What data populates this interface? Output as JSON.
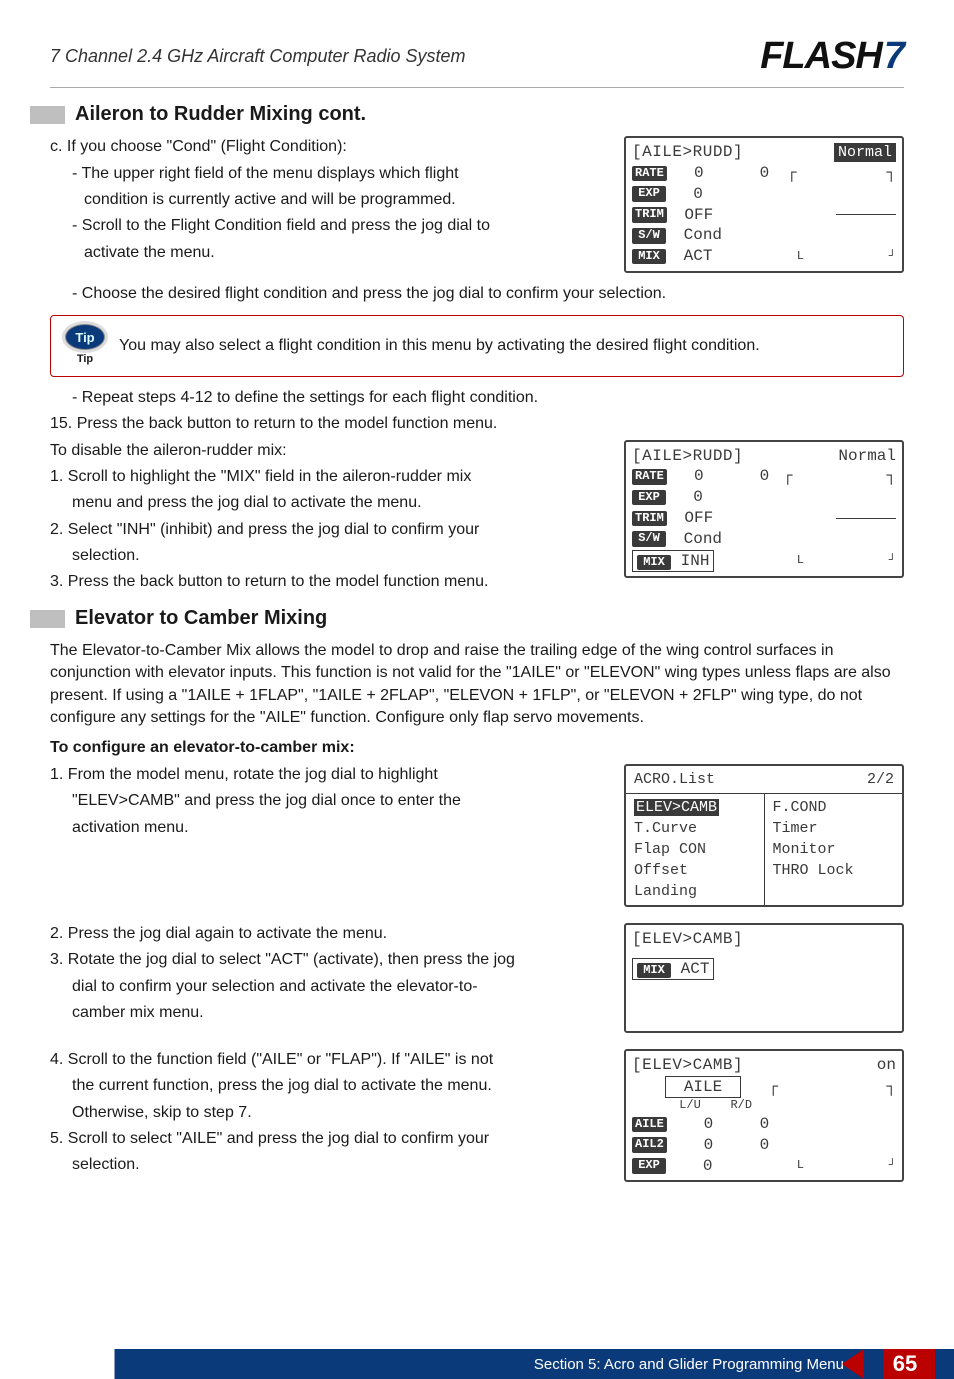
{
  "header": {
    "title_italic": "7 Channel 2.4 GHz Aircraft Computer Radio System",
    "logo_main": "FLASH",
    "logo_num": "7"
  },
  "section1": {
    "title": "Aileron to Rudder Mixing cont.",
    "c_line": "c. If you choose \"Cond\" (Flight Condition):",
    "c1a": "- The upper right field of the menu displays which flight",
    "c1b": "condition is currently active and will be programmed.",
    "c2a": "- Scroll to the Flight Condition field and press the jog dial to",
    "c2b": "activate the menu.",
    "c3": "- Choose the desired flight condition and press the jog dial to confirm your selection.",
    "tip": "You may also select a flight condition in this menu by activating the desired flight condition.",
    "tip_icon": "Tip",
    "tip_label": "Tip",
    "r412": "- Repeat steps 4-12 to define the settings for each flight condition.",
    "s15": "15. Press the back button to return to the model function menu.",
    "disable": "To disable the aileron-rudder mix:",
    "d1a": "1. Scroll to highlight the \"MIX\" field in the aileron-rudder mix",
    "d1b": "menu and press the jog dial to activate the menu.",
    "d2a": "2. Select \"INH\" (inhibit) and press the jog dial to confirm your",
    "d2b": "selection.",
    "d3": "3. Press the back button to return to the model function menu."
  },
  "lcd1": {
    "title": "[AILE>RUDD]",
    "badge_norm": "Normal",
    "rate_lbl": "RATE",
    "rate_v": "0",
    "rate_r": "0",
    "exp_lbl": "EXP",
    "exp_v": "0",
    "trim_lbl": "TRIM",
    "trim_v": "OFF",
    "sw_lbl": "S/W",
    "sw_v": "Cond",
    "mix_lbl": "MIX",
    "mix_v": "ACT",
    "lr_l": "L",
    "lr_r": "┘",
    "bar_r": "┌",
    "bar_top": "┐"
  },
  "lcd2": {
    "title": "[AILE>RUDD]",
    "badge_norm": "Normal",
    "rate_lbl": "RATE",
    "rate_v": "0",
    "rate_r": "0",
    "exp_lbl": "EXP",
    "exp_v": "0",
    "trim_lbl": "TRIM",
    "trim_v": "OFF",
    "sw_lbl": "S/W",
    "sw_v": "Cond",
    "mix_lbl": "MIX",
    "mix_v": "INH"
  },
  "section2": {
    "title": "Elevator to Camber Mixing",
    "para": "The Elevator-to-Camber Mix allows the model to drop and raise the trailing edge of the wing control surfaces in conjunction with elevator inputs. This function is not valid for the \"1AILE\" or \"ELEVON\" wing types unless flaps are also present. If using a \"1AILE + 1FLAP\", \"1AILE + 2FLAP\", \"ELEVON + 1FLP\", or \"ELEVON + 2FLP\" wing type, do not configure any settings for the \"AILE\" function. Configure only flap servo movements.",
    "config_h": "To configure an elevator-to-camber mix:",
    "s1a": "1. From the model menu, rotate the jog dial to highlight",
    "s1b": "\"ELEV>CAMB\" and press the jog dial once to enter the",
    "s1c": "activation menu.",
    "s2": "2. Press the jog dial again to activate the menu.",
    "s3a": "3. Rotate the jog dial to select \"ACT\" (activate), then press the jog",
    "s3b": "dial to confirm your selection and activate the elevator-to-",
    "s3c": "camber mix menu.",
    "s4a": "4. Scroll to the function field (\"AILE\" or \"FLAP\"). If \"AILE\" is not",
    "s4b": "the current function, press the jog dial to activate the menu.",
    "s4c": "Otherwise, skip to step 7.",
    "s5a": "5. Scroll to select \"AILE\" and press the jog dial to confirm your",
    "s5b": "selection."
  },
  "lcd3": {
    "head_l": "ACRO.List",
    "head_r": "2/2",
    "l1": "ELEV>CAMB",
    "r1": "F.COND",
    "l2": "T.Curve",
    "r2": "Timer",
    "l3": "Flap CON",
    "r3": "Monitor",
    "l4": "Offset",
    "r4": "THRO Lock",
    "l5": "Landing"
  },
  "lcd4": {
    "title": "[ELEV>CAMB]",
    "mix_lbl": "MIX",
    "mix_v": "ACT"
  },
  "lcd5": {
    "title": "[ELEV>CAMB]",
    "on": "on",
    "aile": "AILE",
    "lu": "L/U",
    "rd": "R/D",
    "aile_lbl": "AILE",
    "a1": "0",
    "a2": "0",
    "ail2_lbl": "AIL2",
    "b1": "0",
    "b2": "0",
    "exp_lbl": "EXP",
    "c1": "0",
    "l_arrow": "┌",
    "r_arrow": "┐",
    "l_mark": "L",
    "r_mark": "┘"
  },
  "footer": {
    "section_text": "Section 5: Acro and Glider Programming Menu",
    "page": "65"
  }
}
